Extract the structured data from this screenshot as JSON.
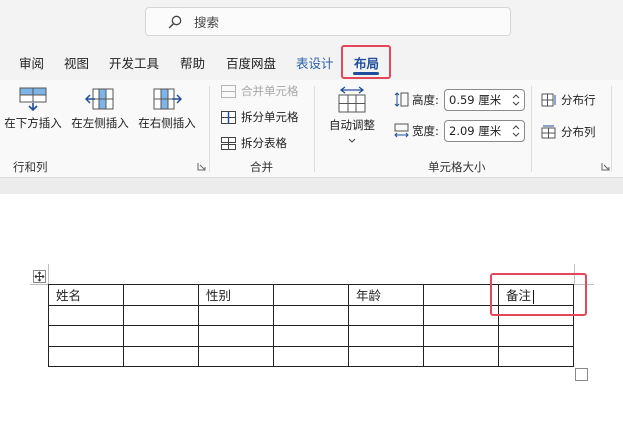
{
  "search": {
    "placeholder": "搜索"
  },
  "tabs": [
    "审阅",
    "视图",
    "开发工具",
    "帮助",
    "百度网盘",
    "表设计",
    "布局"
  ],
  "ribbon": {
    "rows_cols": {
      "insert_below": "在下方插入",
      "insert_left": "在左侧插入",
      "insert_right": "在右侧插入",
      "group": "行和列"
    },
    "merge": {
      "merge_cells": "合并单元格",
      "split_cells": "拆分单元格",
      "split_table": "拆分表格",
      "group": "合并"
    },
    "cell_size": {
      "autofit": "自动调整",
      "height_label": "高度:",
      "height_value": "0.59 厘米",
      "width_label": "宽度:",
      "width_value": "2.09 厘米",
      "distribute_rows": "分布行",
      "distribute_cols": "分布列",
      "group": "单元格大小"
    }
  },
  "table": {
    "header": [
      "姓名",
      "",
      "性别",
      "",
      "年龄",
      "",
      "备注"
    ],
    "rows": [
      [
        "",
        "",
        "",
        "",
        "",
        "",
        ""
      ],
      [
        "",
        "",
        "",
        "",
        "",
        "",
        ""
      ],
      [
        "",
        "",
        "",
        "",
        "",
        "",
        ""
      ]
    ]
  },
  "colors": {
    "accent": "#1f4e9c",
    "highlight": "#e5475a"
  }
}
